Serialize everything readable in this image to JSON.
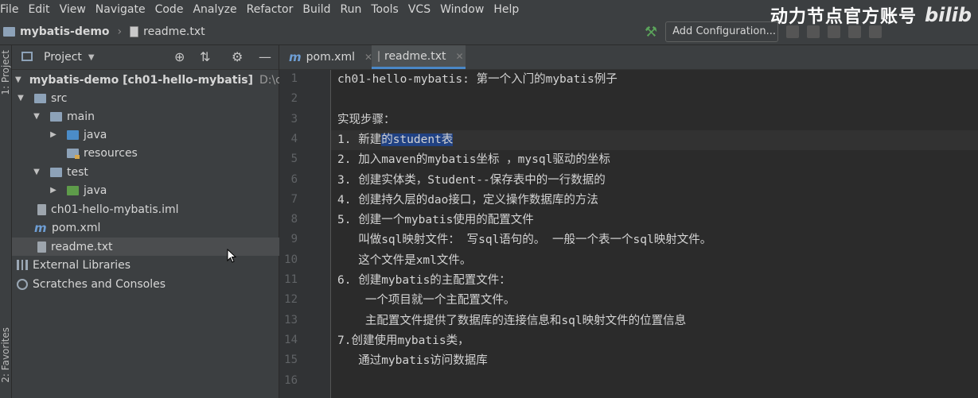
{
  "menu": [
    "File",
    "Edit",
    "View",
    "Navigate",
    "Code",
    "Analyze",
    "Refactor",
    "Build",
    "Run",
    "Tools",
    "VCS",
    "Window",
    "Help"
  ],
  "watermark": {
    "text": "动力节点官方账号",
    "logo": "bilib"
  },
  "breadcrumb": {
    "project": "mybatis-demo",
    "file": "readme.txt"
  },
  "toolbar": {
    "add_configuration": "Add Configuration..."
  },
  "side_tabs": {
    "project": "1: Project",
    "favorites": "2: Favorites"
  },
  "project_panel": {
    "title": "Project",
    "tree": [
      {
        "label": "mybatis-demo [ch01-hello-mybatis]",
        "path": "D:\\course\\",
        "icon": "module-folder-icon"
      },
      {
        "label": "src",
        "icon": "folder-icon"
      },
      {
        "label": "main",
        "icon": "folder-icon"
      },
      {
        "label": "java",
        "icon": "source-folder-icon"
      },
      {
        "label": "resources",
        "icon": "resources-folder-icon"
      },
      {
        "label": "test",
        "icon": "folder-icon"
      },
      {
        "label": "java",
        "icon": "test-folder-icon"
      },
      {
        "label": "ch01-hello-mybatis.iml",
        "icon": "iml-file-icon"
      },
      {
        "label": "pom.xml",
        "icon": "maven-icon"
      },
      {
        "label": "readme.txt",
        "icon": "text-file-icon"
      },
      {
        "label": "External Libraries",
        "icon": "libraries-icon"
      },
      {
        "label": "Scratches and Consoles",
        "icon": "scratches-icon"
      }
    ]
  },
  "editor": {
    "tabs": [
      {
        "label": "pom.xml",
        "icon": "maven-icon",
        "active": false
      },
      {
        "label": "readme.txt",
        "icon": "text-file-icon",
        "active": true
      }
    ],
    "current_line": 4,
    "lines": [
      "ch01-hello-mybatis: 第一个入门的mybatis例子",
      "",
      "实现步骤：",
      "1. 新建的student表",
      "2. 加入maven的mybatis坐标 ，mysql驱动的坐标",
      "3. 创建实体类，Student--保存表中的一行数据的",
      "4. 创建持久层的dao接口，定义操作数据库的方法",
      "5. 创建一个mybatis使用的配置文件",
      "   叫做sql映射文件： 写sql语句的。 一般一个表一个sql映射文件。",
      "   这个文件是xml文件。",
      "6. 创建mybatis的主配置文件：",
      "    一个项目就一个主配置文件。",
      "    主配置文件提供了数据库的连接信息和sql映射文件的位置信息",
      "7.创建使用mybatis类，",
      "   通过mybatis访问数据库",
      ""
    ],
    "line4_prefix": "1. 新建",
    "line4_selected": "的student表"
  }
}
